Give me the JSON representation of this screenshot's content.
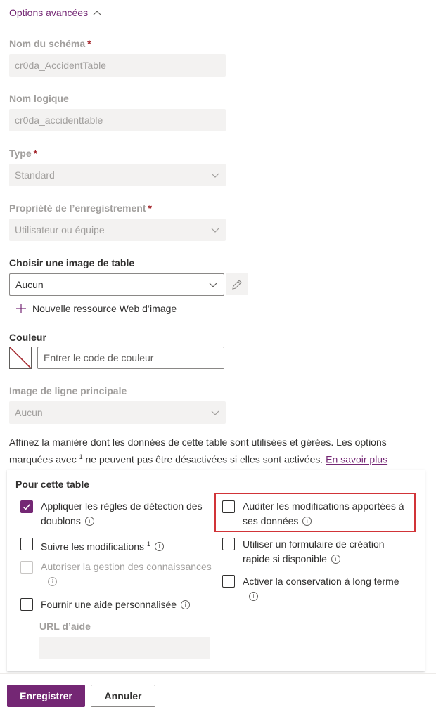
{
  "advanced": {
    "label": "Options avancées"
  },
  "schema_name": {
    "label": "Nom du schéma",
    "required": "*",
    "value": "cr0da_AccidentTable"
  },
  "logical_name": {
    "label": "Nom logique",
    "value": "cr0da_accidenttable"
  },
  "type": {
    "label": "Type",
    "required": "*",
    "value": "Standard"
  },
  "ownership": {
    "label": "Propriété de l’enregistrement",
    "required": "*",
    "value": "Utilisateur ou équipe"
  },
  "table_image": {
    "label": "Choisir une image de table",
    "value": "Aucun",
    "new_resource": "Nouvelle ressource Web d’image"
  },
  "color": {
    "label": "Couleur",
    "placeholder": "Entrer le code de couleur"
  },
  "primary_image": {
    "label": "Image de ligne principale",
    "value": "Aucun"
  },
  "description": {
    "part1": "Affinez la manière dont les données de cette table sont utilisées et gérées. Les options marquées avec",
    "sup": "1",
    "part2": "ne peuvent pas être désactivées si elles sont activées.",
    "link": "En savoir plus"
  },
  "for_table": {
    "title": "Pour cette table",
    "options": {
      "duplicate_detection": {
        "label": "Appliquer les règles de détection des doublons",
        "checked": true
      },
      "track_changes": {
        "label": "Suivre les modifications",
        "sup": "1",
        "checked": false
      },
      "knowledge": {
        "label": "Autoriser la gestion des connaissances",
        "checked": false,
        "disabled": true
      },
      "custom_help": {
        "label": "Fournir une aide personnalisée",
        "checked": false
      },
      "audit": {
        "label": "Auditer les modifications apportées à ses données",
        "checked": false
      },
      "quick_create": {
        "label": "Utiliser un formulaire de création rapide si disponible",
        "checked": false
      },
      "long_term": {
        "label": "Activer la conservation à long terme",
        "checked": false
      }
    },
    "help_url": {
      "label": "URL d’aide",
      "value": ""
    }
  },
  "info_glyph": "i",
  "footer": {
    "save": "Enregistrer",
    "cancel": "Annuler"
  },
  "colors": {
    "accent": "#742774",
    "highlight": "#d13438",
    "disabled_bg": "#f3f2f1"
  }
}
